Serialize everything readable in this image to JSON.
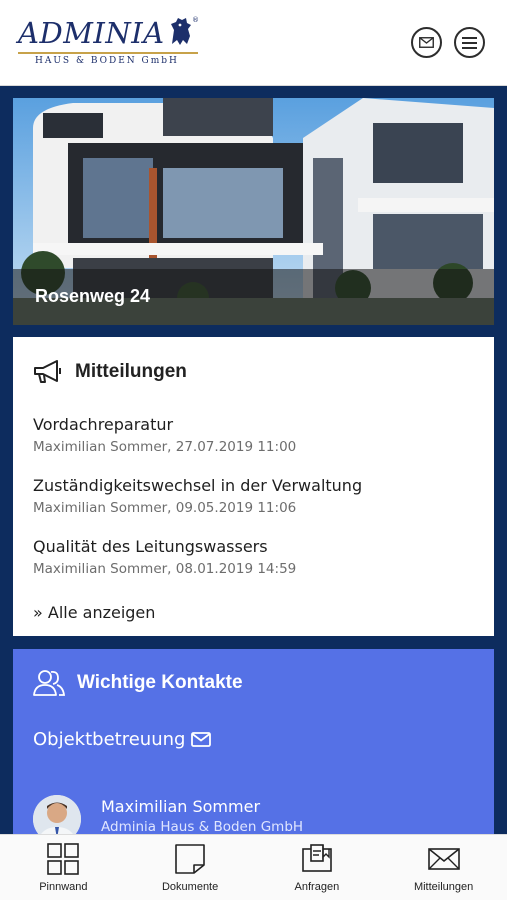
{
  "brand": {
    "name": "ADMINIA",
    "subtitle": "HAUS & BODEN GmbH",
    "registered": "®",
    "navy": "#1d2f6b",
    "gold": "#c7a24a"
  },
  "header": {
    "mail_icon": "envelope-icon",
    "menu_icon": "hamburger-menu-icon"
  },
  "hero": {
    "title": "Rosenweg 24"
  },
  "announcements": {
    "title": "Mitteilungen",
    "icon": "megaphone-icon",
    "items": [
      {
        "title": "Vordachreparatur",
        "meta": "Maximilian Sommer, 27.07.2019 11:00"
      },
      {
        "title": "Zuständigkeitswechsel in der Verwaltung",
        "meta": "Maximilian Sommer, 09.05.2019 11:06"
      },
      {
        "title": "Qualität des Leitungswassers",
        "meta": "Maximilian Sommer, 08.01.2019 14:59"
      }
    ],
    "show_all": "» Alle anzeigen"
  },
  "contacts": {
    "title": "Wichtige Kontakte",
    "icon": "users-icon",
    "role": "Objektbetreuung",
    "person": {
      "name": "Maximilian Sommer",
      "company": "Adminia Haus & Boden GmbH"
    },
    "accent": "#5571e6"
  },
  "nav": {
    "items": [
      {
        "label": "Pinnwand",
        "icon": "grid-icon"
      },
      {
        "label": "Dokumente",
        "icon": "document-icon"
      },
      {
        "label": "Anfragen",
        "icon": "requests-icon"
      },
      {
        "label": "Mitteilungen",
        "icon": "envelope-icon"
      }
    ]
  },
  "colors": {
    "background": "#0d2c5e",
    "card": "#ffffff"
  }
}
